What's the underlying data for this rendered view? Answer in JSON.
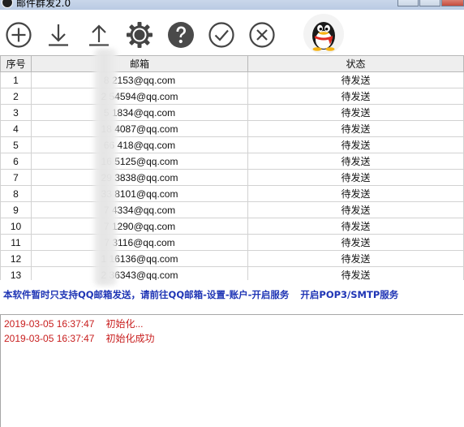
{
  "window": {
    "title": "邮件群发2.0"
  },
  "toolbar": {
    "buttons": [
      {
        "name": "add",
        "icon": "plus-circle-icon"
      },
      {
        "name": "download",
        "icon": "download-arrow-icon"
      },
      {
        "name": "upload",
        "icon": "upload-arrow-icon"
      },
      {
        "name": "settings",
        "icon": "gear-icon"
      },
      {
        "name": "help",
        "icon": "question-icon"
      },
      {
        "name": "start",
        "icon": "checkmark-circle-icon"
      },
      {
        "name": "stop",
        "icon": "x-circle-icon"
      }
    ],
    "avatar_icon": "qq-penguin-icon"
  },
  "table": {
    "headers": [
      "序号",
      "邮箱",
      "状态"
    ],
    "rows": [
      {
        "no": "1",
        "email": "8  2153@qq.com",
        "status": "待发送"
      },
      {
        "no": "2",
        "email": "2  54594@qq.com",
        "status": "待发送"
      },
      {
        "no": "3",
        "email": "5  1834@qq.com",
        "status": "待发送"
      },
      {
        "no": "4",
        "email": "18  4087@qq.com",
        "status": "待发送"
      },
      {
        "no": "5",
        "email": "66  418@qq.com",
        "status": "待发送"
      },
      {
        "no": "6",
        "email": "16  5125@qq.com",
        "status": "待发送"
      },
      {
        "no": "7",
        "email": "29  3838@qq.com",
        "status": "待发送"
      },
      {
        "no": "8",
        "email": "33  8101@qq.com",
        "status": "待发送"
      },
      {
        "no": "9",
        "email": "7  4334@qq.com",
        "status": "待发送"
      },
      {
        "no": "10",
        "email": "7  1290@qq.com",
        "status": "待发送"
      },
      {
        "no": "11",
        "email": "7  3116@qq.com",
        "status": "待发送"
      },
      {
        "no": "12",
        "email": "1  16136@qq.com",
        "status": "待发送"
      },
      {
        "no": "13",
        "email": "2  36343@qq.com",
        "status": "待发送"
      }
    ]
  },
  "notice": {
    "text1": "本软件暂时只支持QQ邮箱发送，请前往QQ邮箱-设置-账户-开启服务",
    "text2": "开启POP3/SMTP服务",
    "color": "#1f35b5"
  },
  "log": {
    "color": "#c81e1e",
    "entries": [
      {
        "time": "2019-03-05 16:37:47",
        "message": "初始化..."
      },
      {
        "time": "2019-03-05 16:37:47",
        "message": "初始化成功"
      }
    ]
  }
}
